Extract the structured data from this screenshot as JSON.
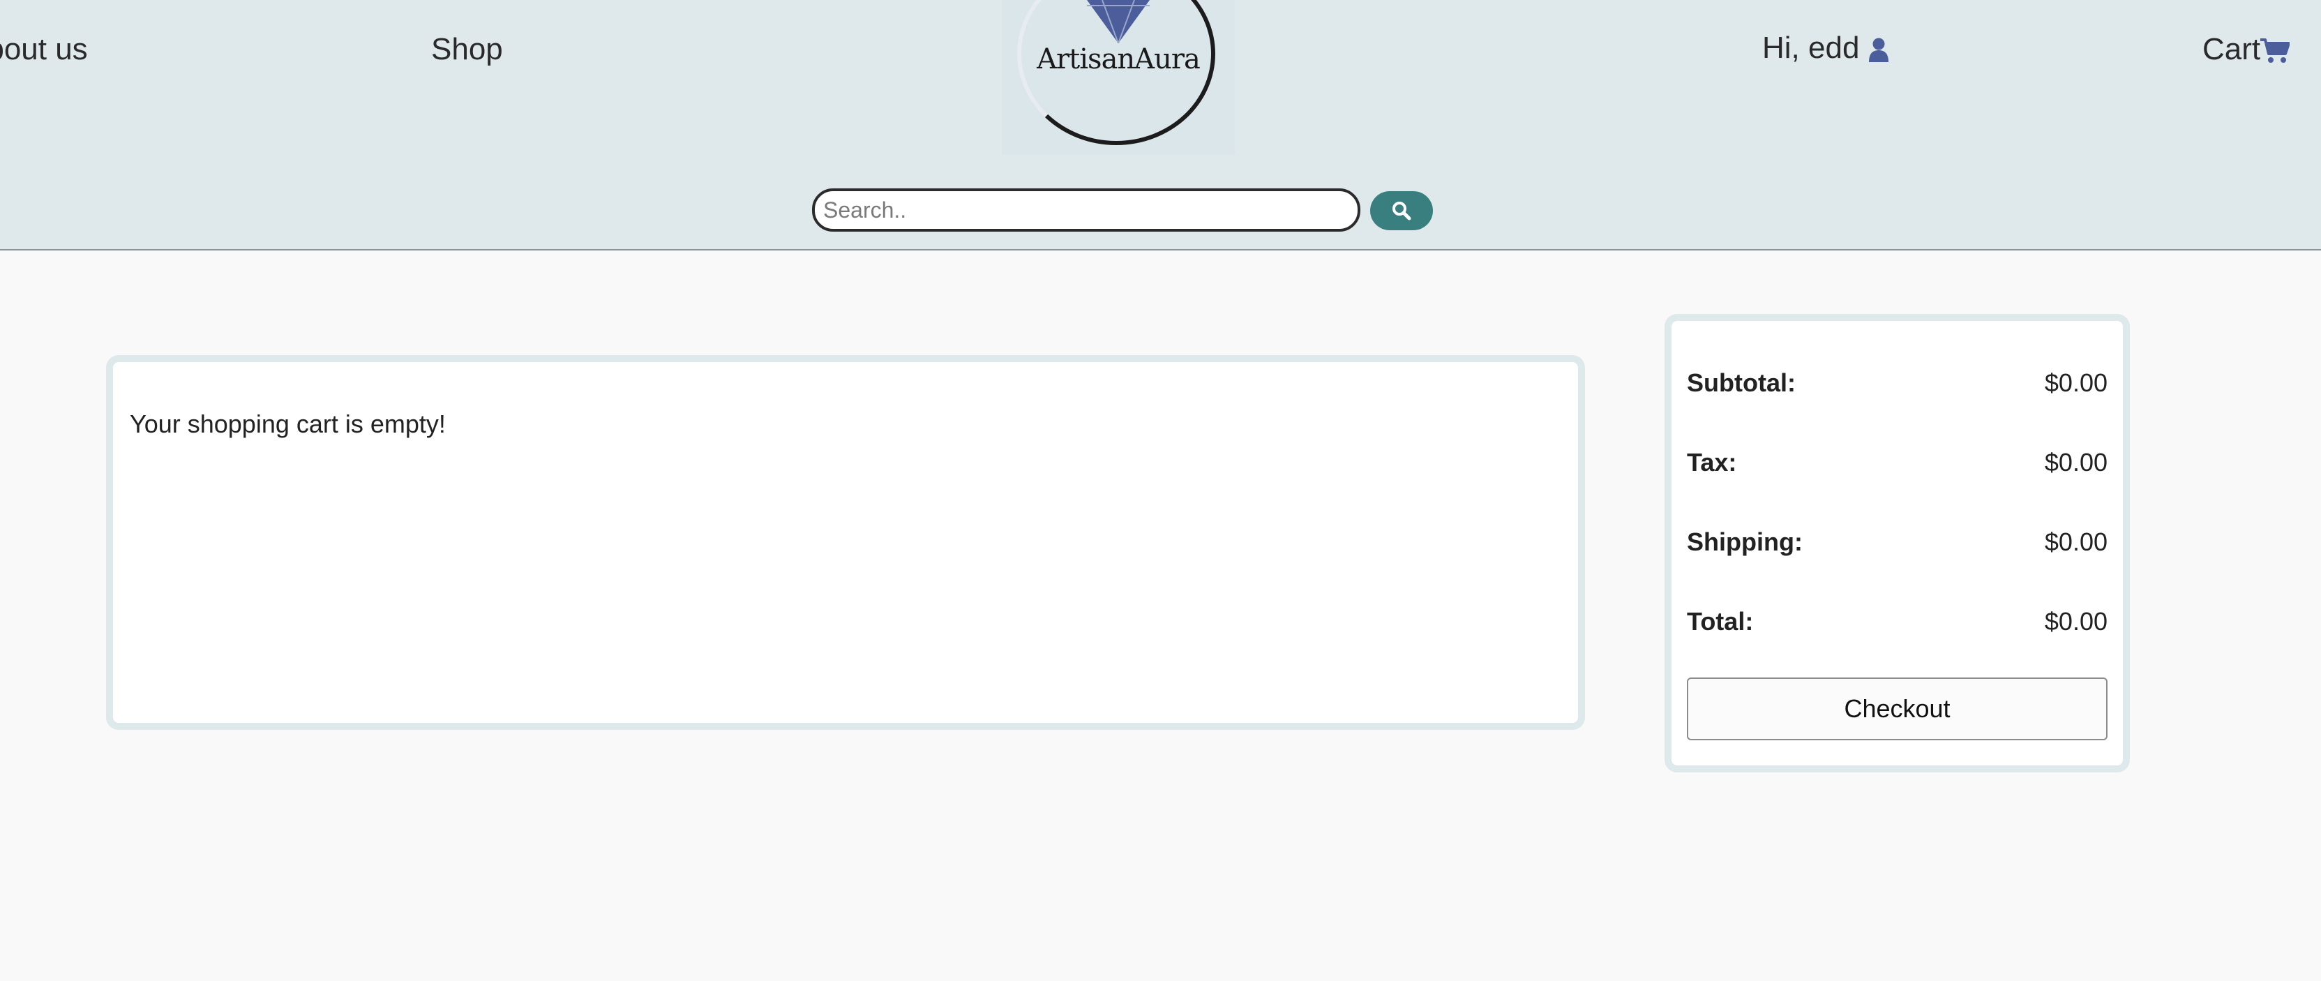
{
  "nav": {
    "about_label": "About us",
    "shop_label": "Shop",
    "user_greeting": "Hi, edd",
    "cart_label": "Cart"
  },
  "logo": {
    "brand_name": "ArtisanAura",
    "icon": "diamond-icon"
  },
  "search": {
    "placeholder": "Search..",
    "value": "",
    "button_icon": "search-icon"
  },
  "cart": {
    "empty_message": "Your shopping cart is empty!"
  },
  "summary": {
    "subtotal_label": "Subtotal:",
    "subtotal_value": "$0.00",
    "tax_label": "Tax:",
    "tax_value": "$0.00",
    "shipping_label": "Shipping:",
    "shipping_value": "$0.00",
    "total_label": "Total:",
    "total_value": "$0.00",
    "checkout_label": "Checkout"
  },
  "colors": {
    "header_bg": "#dfe9ec",
    "accent": "#3a7f80",
    "icon_blue": "#4b5d9a",
    "panel_border": "#dde9eb"
  }
}
